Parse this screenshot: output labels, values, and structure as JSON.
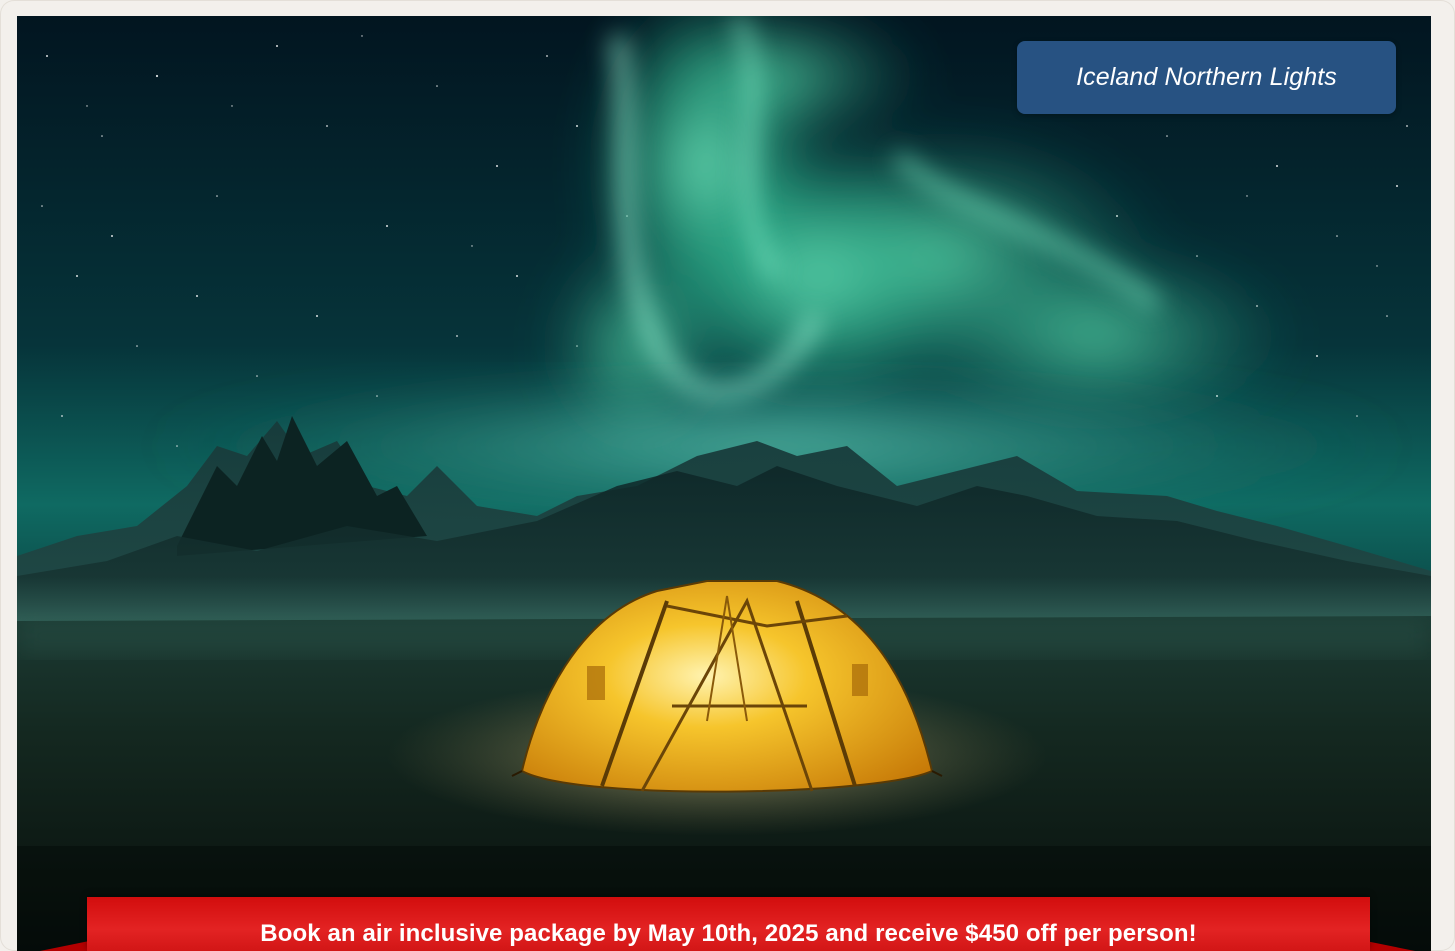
{
  "banner": {
    "title": "Iceland Northern Lights",
    "promo": "Book an air inclusive package by May 10th, 2025 and receive $450 off per person!"
  },
  "hero_image": {
    "icon": "aurora-landscape-image"
  },
  "colors": {
    "page_background": "#f3f0ec",
    "title_pill": "#275282",
    "promo_bar": "#dd1a1a",
    "aurora": "#3dd9a8",
    "tent": "#f2b31a",
    "sky": "#031722"
  }
}
